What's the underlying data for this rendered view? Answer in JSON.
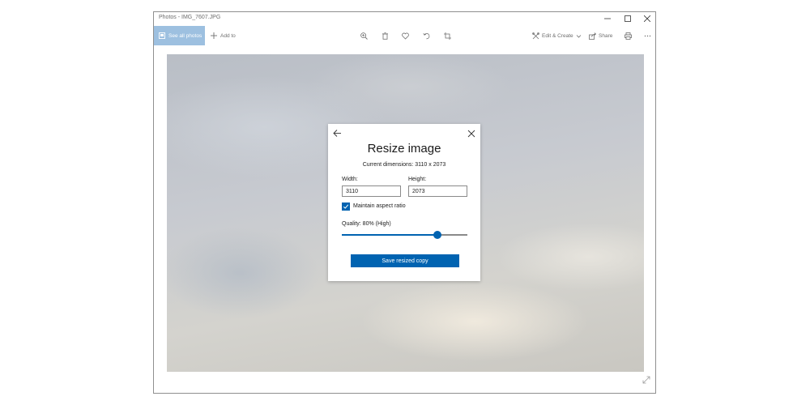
{
  "window": {
    "title": "Photos - IMG_7607.JPG"
  },
  "toolbar": {
    "see_all_label": "See all photos",
    "add_to_label": "Add to",
    "edit_create_label": "Edit & Create",
    "share_label": "Share",
    "icons": [
      "zoom-in-icon",
      "delete-icon",
      "heart-icon",
      "rotate-icon",
      "crop-icon",
      "edit-create-icon",
      "share-icon",
      "print-icon",
      "more-icon"
    ]
  },
  "dialog": {
    "title": "Resize image",
    "current_dimensions": "Current dimensions: 3110 x 2073",
    "width_label": "Width:",
    "width_value": "3110",
    "height_label": "Height:",
    "height_value": "2073",
    "maintain_label": "Maintain aspect ratio",
    "maintain_checked": true,
    "quality_label": "Quality: 80% (High)",
    "quality_fraction": 0.76,
    "save_label": "Save resized copy"
  },
  "colors": {
    "accent": "#0063b1",
    "see_all_bg": "#9dc0e0"
  }
}
